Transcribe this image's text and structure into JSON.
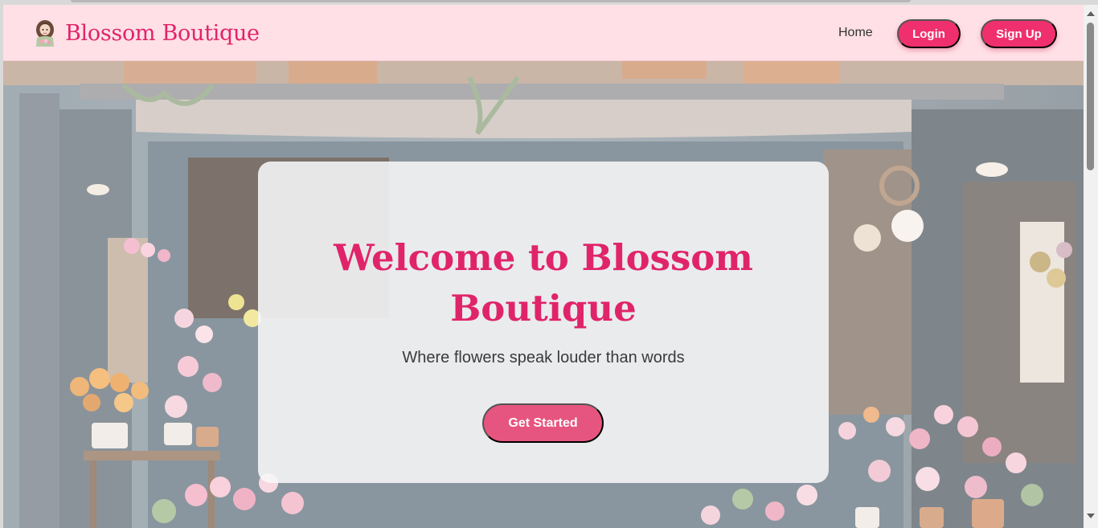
{
  "navbar": {
    "brand_name": "Blossom Boutique",
    "logo_icon": "florist-girl-icon",
    "links": {
      "home": "Home",
      "login": "Login",
      "signup": "Sign Up"
    }
  },
  "hero": {
    "title": "Welcome to Blossom Boutique",
    "subtitle": "Where flowers speak louder than words",
    "cta_label": "Get Started",
    "background": "flower-shop-storefront-photo"
  },
  "colors": {
    "accent": "#e0246a",
    "nav_bg": "#ffe0e6",
    "button": "#f0306e",
    "cta": "#e6557f"
  }
}
